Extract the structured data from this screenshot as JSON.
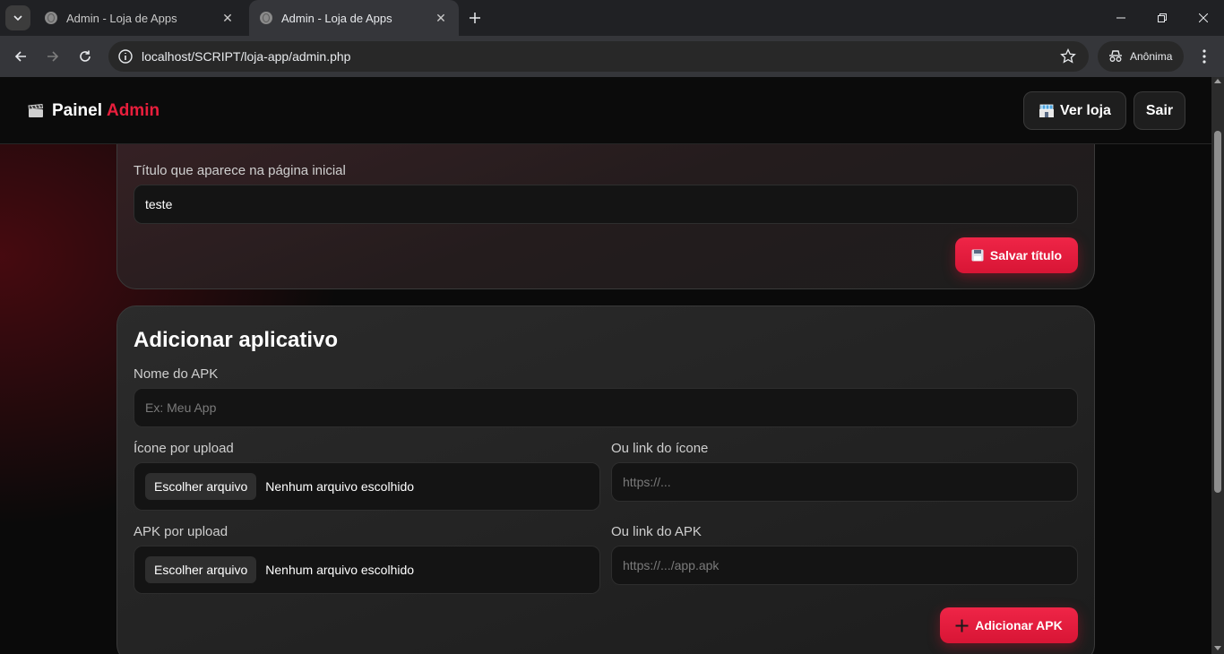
{
  "browser": {
    "tabs": [
      {
        "title": "Admin - Loja de Apps",
        "active": false
      },
      {
        "title": "Admin - Loja de Apps",
        "active": true
      }
    ],
    "url": "localhost/SCRIPT/loja-app/admin.php",
    "incognito_label": "Anônima"
  },
  "header": {
    "brand_main": "Painel",
    "brand_accent": "Admin",
    "store_button": "Ver loja",
    "logout_button": "Sair"
  },
  "title_card": {
    "field_label": "Título que aparece na página inicial",
    "field_value": "teste",
    "save_button": "Salvar título"
  },
  "add_app_card": {
    "title": "Adicionar aplicativo",
    "name_label": "Nome do APK",
    "name_placeholder": "Ex: Meu App",
    "icon_upload_label": "Ícone por upload",
    "icon_link_label": "Ou link do ícone",
    "icon_link_placeholder": "https://...",
    "apk_upload_label": "APK por upload",
    "apk_link_label": "Ou link do APK",
    "apk_link_placeholder": "https://.../app.apk",
    "choose_file": "Escolher arquivo",
    "no_file": "Nenhum arquivo escolhido",
    "add_button": "Adicionar APK"
  },
  "colors": {
    "accent": "#e81e3c",
    "background": "#0a0a0a",
    "card": "#242424"
  }
}
